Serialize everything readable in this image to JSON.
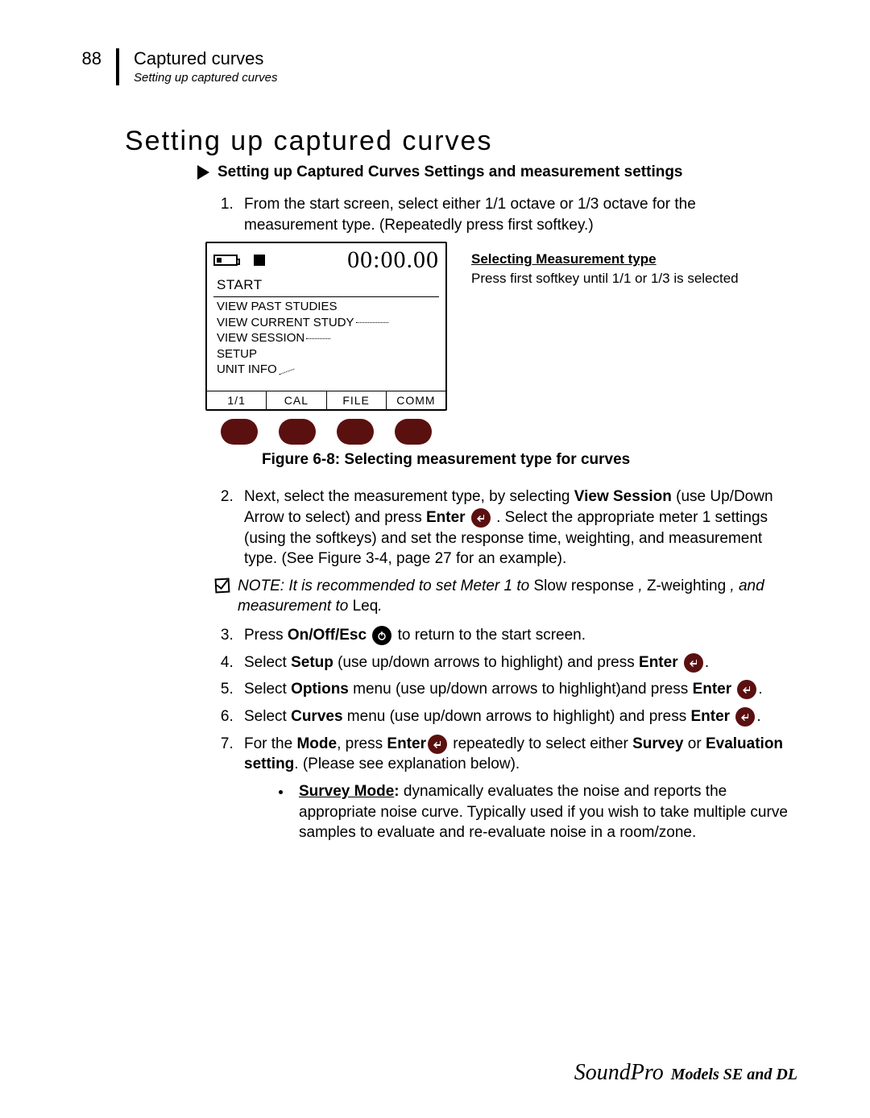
{
  "header": {
    "page_number": "88",
    "chapter": "Captured curves",
    "section": "Setting up captured curves"
  },
  "heading": "Setting up captured curves",
  "subheading": "Setting up Captured Curves Settings and measurement settings",
  "step1": "From the start screen, select either 1/1 octave or 1/3 octave for the measurement type. (Repeatedly press first softkey.)",
  "device": {
    "timer": "00:00.00",
    "start": "START",
    "menu": {
      "view_past": "VIEW PAST STUDIES",
      "view_current": "VIEW CURRENT STUDY",
      "view_session": "VIEW SESSION",
      "setup": "SETUP",
      "unit_info": "UNIT INFO"
    },
    "softlabels": {
      "a": "1/1",
      "b": "CAL",
      "c": "FILE",
      "d": "COMM"
    }
  },
  "callout": {
    "title": "Selecting Measurement type",
    "text": "Press first softkey until 1/1 or 1/3 is selected"
  },
  "fig_caption": "Figure 6-8:  Selecting measurement type for curves",
  "step2": {
    "a": "Next, select the measurement type, by selecting ",
    "b_bold": "View Session",
    "c": " (use Up/Down Arrow to select) and press ",
    "d_bold": "Enter",
    "e": " .   Select the appropriate meter 1 settings (using the softkeys) and set the response time, weighting, and measurement type.  (See Figure 3-4, page 27 for an example)."
  },
  "note": {
    "a": "NOTE:  It is recommended to set Meter 1 to ",
    "b_plain": "Slow response",
    "c": "  , ",
    "d_plain": "Z-weighting",
    "e": "  , and measurement to ",
    "f_plain": "Leq",
    "g": "."
  },
  "step3": {
    "a": "Press ",
    "b_bold": "On/Off/Esc",
    "c": "  to return to the start screen."
  },
  "step4": {
    "a": "Select ",
    "b_bold": "Setup",
    "c": " (use up/down arrows to highlight) and press ",
    "d_bold": "Enter",
    "e": "."
  },
  "step5": {
    "a": "Select ",
    "b_bold": "Options",
    "c": " menu (use up/down arrows to highlight)and press ",
    "d_bold": "Enter",
    "e": "."
  },
  "step6": {
    "a": "Select ",
    "b_bold": "Curves",
    "c": " menu (use up/down arrows to highlight) and press ",
    "d_bold": "Enter",
    "e": "."
  },
  "step7": {
    "a": "For the ",
    "b_bold": "Mode",
    "c": ", press ",
    "d_bold": "Enter",
    "e": " repeatedly to select either ",
    "f_bold": "Survey",
    "g": " or ",
    "h_bold": "Evaluation setting",
    "i": ".   (Please see explanation below)."
  },
  "survey_mode": {
    "label": "Survey Mode",
    "colon": ":",
    "text": " dynamically evaluates the noise and reports the appropriate noise curve.  Typically used if you wish to take multiple curve samples to evaluate and re-evaluate noise in a room/zone."
  },
  "footer": {
    "brand": "SoundPro",
    "models": " Models SE and DL"
  }
}
